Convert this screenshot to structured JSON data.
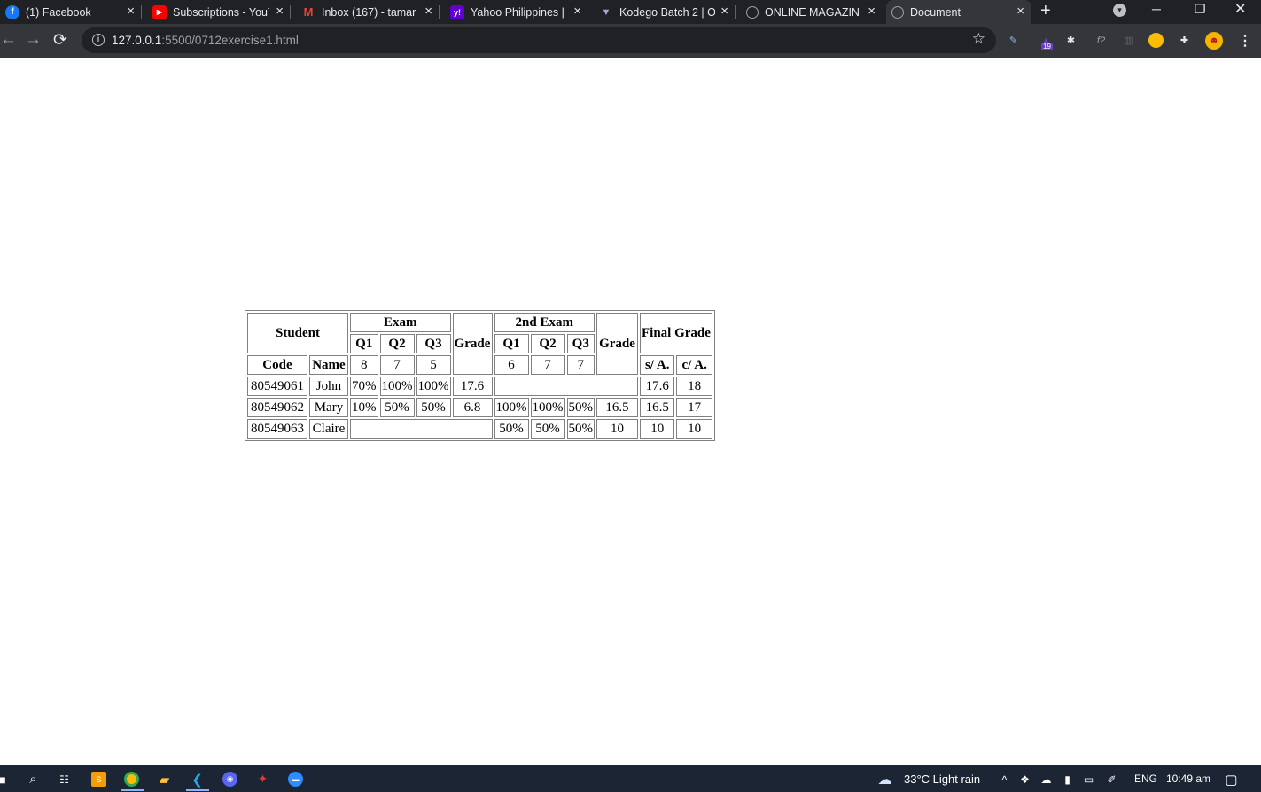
{
  "browser": {
    "tabs": [
      {
        "title": "(1) Facebook",
        "icon": "facebook-icon",
        "color": "#1877f2",
        "glyph": "f"
      },
      {
        "title": "Subscriptions - YouTube",
        "icon": "youtube-icon",
        "color": "#ff0000",
        "glyph": "▶"
      },
      {
        "title": "Inbox (167) - tamar",
        "icon": "gmail-icon",
        "color": "#ea4335",
        "glyph": "M"
      },
      {
        "title": "Yahoo Philippines | ",
        "icon": "yahoo-icon",
        "color": "#6001d2",
        "glyph": "y!"
      },
      {
        "title": "Kodego Batch 2 | O",
        "icon": "kodego-icon",
        "color": "#7e57c2",
        "glyph": "▼"
      },
      {
        "title": "ONLINE MAGAZINE",
        "icon": "globe-icon",
        "color": "#5f6368",
        "glyph": "◌"
      },
      {
        "title": "Document",
        "icon": "globe-icon",
        "color": "#5f6368",
        "glyph": "◌",
        "active": true
      }
    ],
    "new_tab_label": "+",
    "address": {
      "host": "127.0.0.1",
      "path": ":5500/0712exercise1.html"
    },
    "extension_badge": "19"
  },
  "table": {
    "header_row1": {
      "student": "Student",
      "exam": "Exam",
      "exam2": "2nd Exam",
      "final": "Final Grade"
    },
    "header_row2": {
      "q1": "Q1",
      "q2": "Q2",
      "q3": "Q3",
      "grade": "Grade",
      "q1b": "Q1",
      "q2b": "Q2",
      "q3b": "Q3",
      "grade2": "Grade"
    },
    "header_row3": {
      "code": "Code",
      "name": "Name",
      "e1": "8",
      "e2": "7",
      "e3": "5",
      "s1": "6",
      "s2": "7",
      "s3": "7",
      "sa": "s/ A.",
      "ca": "c/ A."
    },
    "rows": [
      {
        "code": "80549061",
        "name": "John",
        "q1": "70%",
        "q2": "100%",
        "q3": "100%",
        "grade": "17.6",
        "sa": "17.6",
        "ca": "18"
      },
      {
        "code": "80549062",
        "name": "Mary",
        "q1": "10%",
        "q2": "50%",
        "q3": "50%",
        "grade": "6.8",
        "q1b": "100%",
        "q2b": "100%",
        "q3b": "50%",
        "grade2": "16.5",
        "sa": "16.5",
        "ca": "17"
      },
      {
        "code": "80549063",
        "name": "Claire",
        "q1b": "50%",
        "q2b": "50%",
        "q3b": "50%",
        "grade2": "10",
        "sa": "10",
        "ca": "10"
      }
    ]
  },
  "taskbar": {
    "weather": "33°C  Light rain",
    "language": "ENG",
    "time": "10:49 am"
  }
}
